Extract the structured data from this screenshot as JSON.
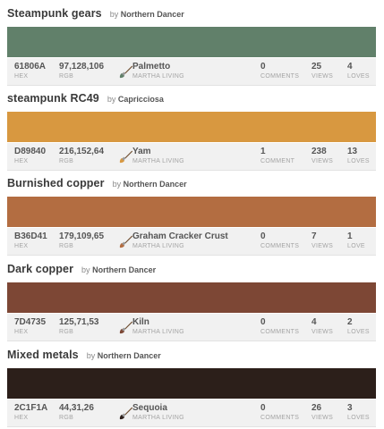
{
  "labels": {
    "hex": "HEX",
    "rgb": "RGB",
    "source": "MARTHA LIVING",
    "comments_plural": "COMMENTS",
    "comments_singular": "COMMENT",
    "views": "VIEWS",
    "loves_plural": "LOVES",
    "loves_singular": "LOVE",
    "by": "by"
  },
  "colors": [
    {
      "title": "Steampunk gears",
      "author": "Northern Dancer",
      "hex": "61806A",
      "rgb": "97,128,106",
      "swatch_color": "#61806A",
      "name": "Palmetto",
      "source": "MARTHA LIVING",
      "comments": "0",
      "comments_label": "COMMENTS",
      "views": "25",
      "views_label": "VIEWS",
      "loves": "4",
      "loves_label": "LOVES"
    },
    {
      "title": "steampunk RC49",
      "author": "Capricciosa",
      "hex": "D89840",
      "rgb": "216,152,64",
      "swatch_color": "#D89840",
      "name": "Yam",
      "source": "MARTHA LIVING",
      "comments": "1",
      "comments_label": "COMMENT",
      "views": "238",
      "views_label": "VIEWS",
      "loves": "13",
      "loves_label": "LOVES"
    },
    {
      "title": "Burnished copper",
      "author": "Northern Dancer",
      "hex": "B36D41",
      "rgb": "179,109,65",
      "swatch_color": "#B36D41",
      "name": "Graham Cracker Crust",
      "source": "MARTHA LIVING",
      "comments": "0",
      "comments_label": "COMMENTS",
      "views": "7",
      "views_label": "VIEWS",
      "loves": "1",
      "loves_label": "LOVE"
    },
    {
      "title": "Dark copper",
      "author": "Northern Dancer",
      "hex": "7D4735",
      "rgb": "125,71,53",
      "swatch_color": "#7D4735",
      "name": "Kiln",
      "source": "MARTHA LIVING",
      "comments": "0",
      "comments_label": "COMMENTS",
      "views": "4",
      "views_label": "VIEWS",
      "loves": "2",
      "loves_label": "LOVES"
    },
    {
      "title": "Mixed metals",
      "author": "Northern Dancer",
      "hex": "2C1F1A",
      "rgb": "44,31,26",
      "swatch_color": "#2C1F1A",
      "name": "Sequoia",
      "source": "MARTHA LIVING",
      "comments": "0",
      "comments_label": "COMMENTS",
      "views": "26",
      "views_label": "VIEWS",
      "loves": "3",
      "loves_label": "LOVES"
    }
  ]
}
